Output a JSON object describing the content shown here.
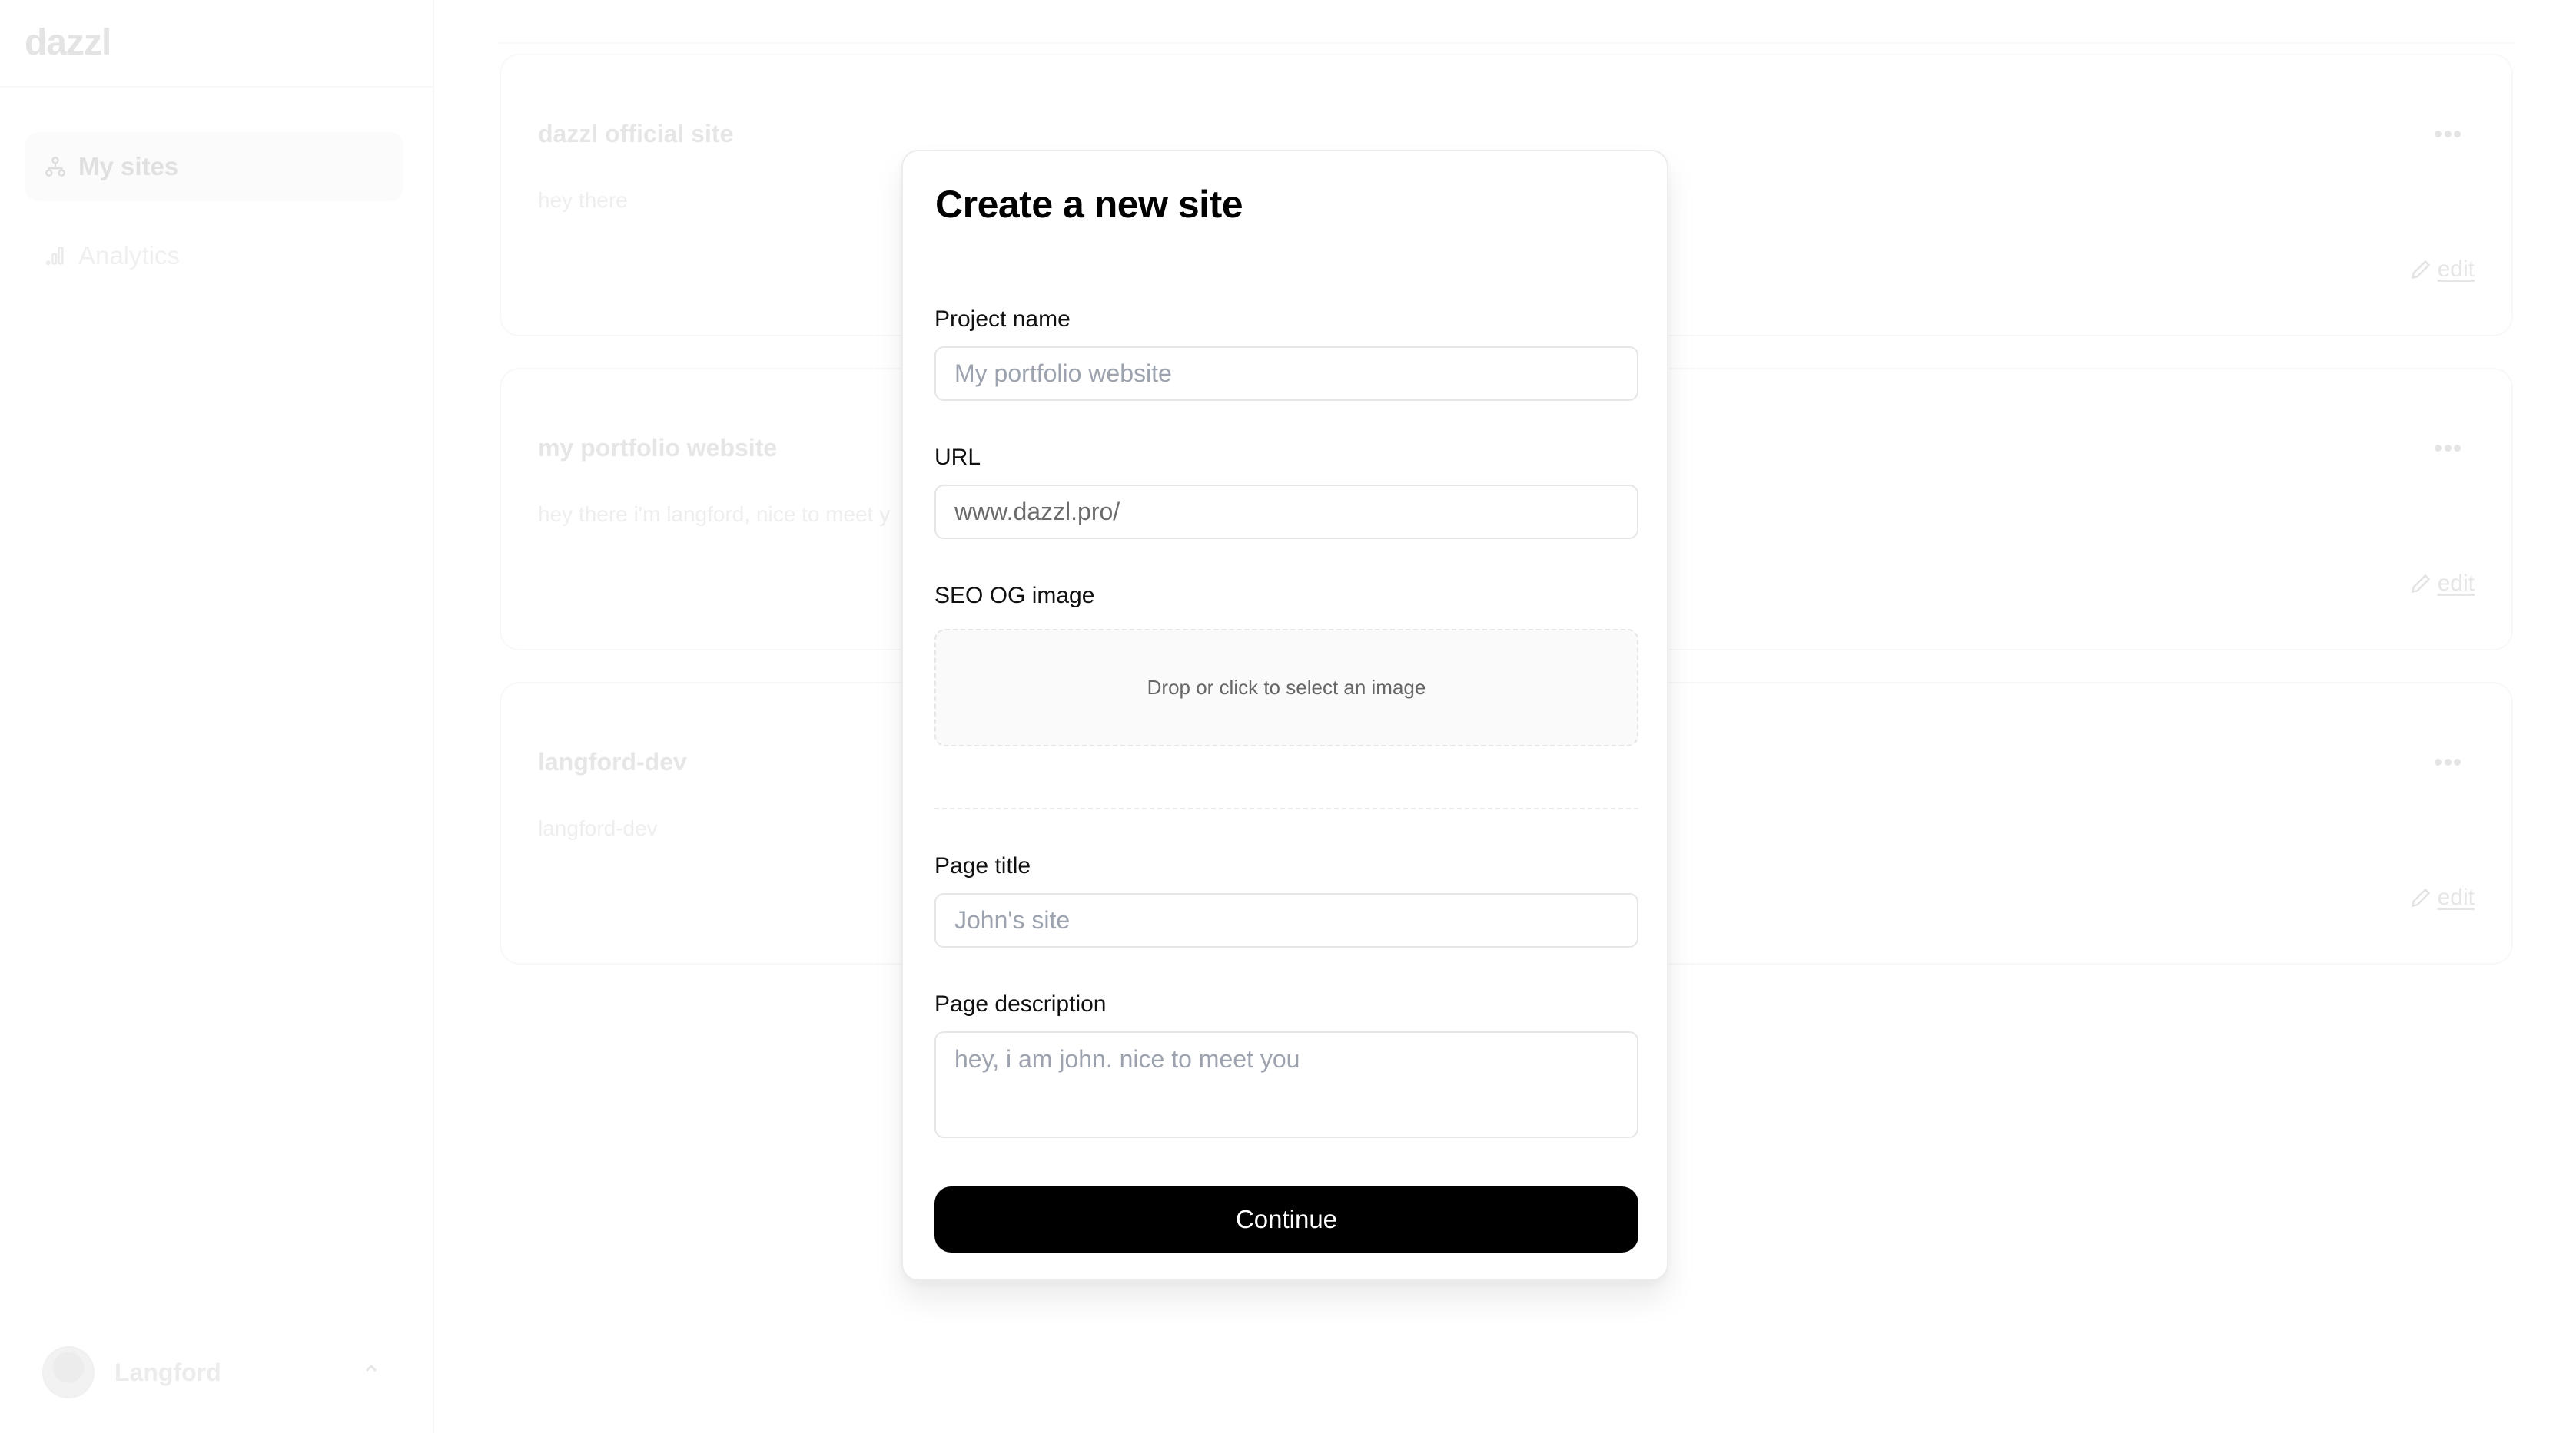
{
  "app": {
    "logo": "dazzl"
  },
  "sidebar": {
    "items": [
      {
        "label": "My sites",
        "icon": "sitemap-icon",
        "active": true
      },
      {
        "label": "Analytics",
        "icon": "bar-chart-icon",
        "active": false
      }
    ],
    "user": {
      "name": "Langford",
      "menu_icon": "chevron-up-icon"
    }
  },
  "sites": [
    {
      "title": "dazzl official site",
      "description": "hey there",
      "edit_label": "edit"
    },
    {
      "title": "my portfolio website",
      "description": "hey there i'm langford, nice to meet y",
      "edit_label": "edit"
    },
    {
      "title": "langford-dev",
      "description": "langford-dev",
      "edit_label": "edit"
    }
  ],
  "modal": {
    "title": "Create a new site",
    "fields": {
      "project_name": {
        "label": "Project name",
        "value": "",
        "placeholder": "My portfolio website"
      },
      "url": {
        "label": "URL",
        "value": "www.dazzl.pro/",
        "placeholder": ""
      },
      "og_image": {
        "label": "SEO OG image",
        "dropzone_text": "Drop or click to select an image"
      },
      "page_title": {
        "label": "Page title",
        "value": "",
        "placeholder": "John's site"
      },
      "page_description": {
        "label": "Page description",
        "value": "",
        "placeholder": "hey, i am john. nice to meet you"
      }
    },
    "submit_label": "Continue"
  },
  "colors": {
    "primary_button": "#000000",
    "primary_button_text": "#ffffff",
    "placeholder": "#9ca3af",
    "input_border": "#e6e6e6",
    "dimmed_text": "#e6e6e6"
  }
}
